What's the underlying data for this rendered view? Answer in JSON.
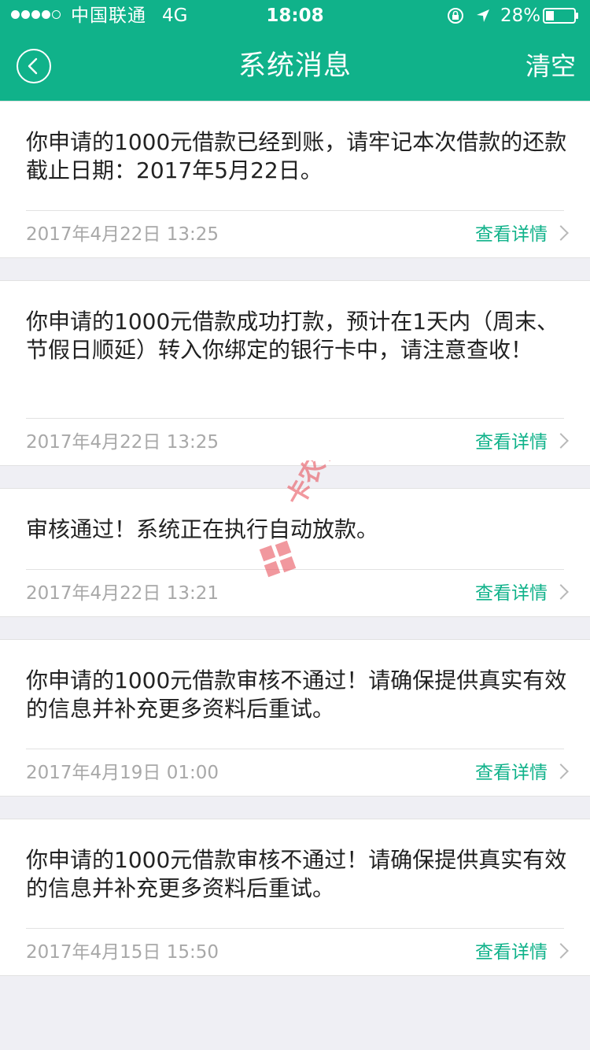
{
  "status_bar": {
    "carrier": "中国联通",
    "network": "4G",
    "time": "18:08",
    "battery": "28%"
  },
  "nav": {
    "title": "系统消息",
    "clear_label": "清空"
  },
  "colors": {
    "accent": "#10b28a",
    "background": "#efeff4"
  },
  "messages": [
    {
      "body": "你申请的1000元借款已经到账，请牢记本次借款的还款截止日期：2017年5月22日。",
      "time": "2017年4月22日 13:25",
      "detail_label": "查看详情"
    },
    {
      "body": "你申请的1000元借款成功打款，预计在1天内（周末、节假日顺延）转入你绑定的银行卡中，请注意查收！",
      "time": "2017年4月22日 13:25",
      "detail_label": "查看详情"
    },
    {
      "body": "审核通过！系统正在执行自动放款。",
      "time": "2017年4月22日 13:21",
      "detail_label": "查看详情"
    },
    {
      "body": "你申请的1000元借款审核不通过！请确保提供真实有效的信息并补充更多资料后重试。",
      "time": "2017年4月19日 01:00",
      "detail_label": "查看详情"
    },
    {
      "body": "你申请的1000元借款审核不通过！请确保提供真实有效的信息并补充更多资料后重试。",
      "time": "2017年4月15日 15:50",
      "detail_label": "查看详情"
    }
  ],
  "watermark": {
    "text": "卡农社区"
  }
}
